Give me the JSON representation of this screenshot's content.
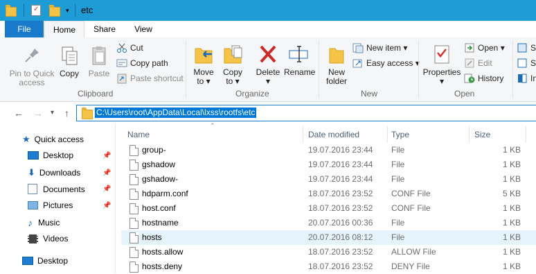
{
  "window": {
    "title": "etc"
  },
  "tabs": [
    {
      "label": "File"
    },
    {
      "label": "Home"
    },
    {
      "label": "Share"
    },
    {
      "label": "View"
    }
  ],
  "ribbon": {
    "clipboard": {
      "label": "Clipboard",
      "pin": "Pin to Quick\naccess",
      "copy": "Copy",
      "paste": "Paste",
      "cut": "Cut",
      "copy_path": "Copy path",
      "paste_shortcut": "Paste shortcut"
    },
    "organize": {
      "label": "Organize",
      "move_to": "Move\nto ▾",
      "copy_to": "Copy\nto ▾",
      "delete": "Delete\n▾",
      "rename": "Rename"
    },
    "new": {
      "label": "New",
      "new_folder": "New\nfolder",
      "new_item": "New item ▾",
      "easy_access": "Easy access ▾"
    },
    "open": {
      "label": "Open",
      "properties": "Properties\n▾",
      "open": "Open ▾",
      "edit": "Edit",
      "history": "History"
    },
    "select": {
      "select_all": "Se",
      "select_none": "Se",
      "invert": "In"
    }
  },
  "address": {
    "path": "C:\\Users\\root\\AppData\\Local\\lxss\\rootfs\\etc"
  },
  "sidebar": {
    "items": [
      {
        "label": "Quick access"
      },
      {
        "label": "Desktop"
      },
      {
        "label": "Downloads"
      },
      {
        "label": "Documents"
      },
      {
        "label": "Pictures"
      },
      {
        "label": "Music"
      },
      {
        "label": "Videos"
      },
      {
        "label": "Desktop"
      }
    ]
  },
  "columns": {
    "name": "Name",
    "date": "Date modified",
    "type": "Type",
    "size": "Size"
  },
  "files": [
    {
      "name": "group-",
      "date": "19.07.2016 23:44",
      "type": "File",
      "size": "1 KB"
    },
    {
      "name": "gshadow",
      "date": "19.07.2016 23:44",
      "type": "File",
      "size": "1 KB"
    },
    {
      "name": "gshadow-",
      "date": "19.07.2016 23:44",
      "type": "File",
      "size": "1 KB"
    },
    {
      "name": "hdparm.conf",
      "date": "18.07.2016 23:52",
      "type": "CONF File",
      "size": "5 KB"
    },
    {
      "name": "host.conf",
      "date": "18.07.2016 23:52",
      "type": "CONF File",
      "size": "1 KB"
    },
    {
      "name": "hostname",
      "date": "20.07.2016 00:36",
      "type": "File",
      "size": "1 KB"
    },
    {
      "name": "hosts",
      "date": "20.07.2016 08:12",
      "type": "File",
      "size": "1 KB"
    },
    {
      "name": "hosts.allow",
      "date": "18.07.2016 23:52",
      "type": "ALLOW File",
      "size": "1 KB"
    },
    {
      "name": "hosts.deny",
      "date": "18.07.2016 23:52",
      "type": "DENY File",
      "size": "1 KB"
    }
  ],
  "colors": {
    "titlebar": "#1f9bd5",
    "file_tab": "#1979ca",
    "selection": "#0078d7",
    "row_hover": "#e5f3fb"
  }
}
